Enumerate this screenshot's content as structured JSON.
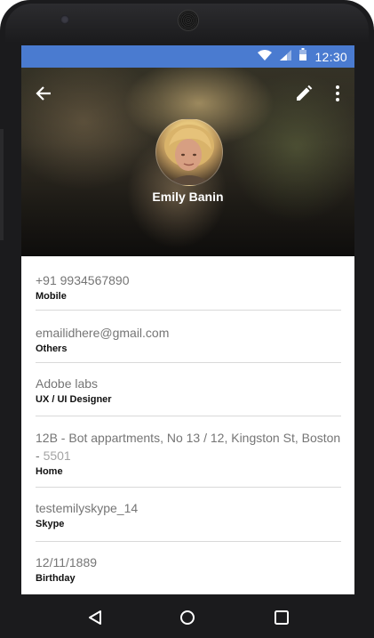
{
  "status_bar": {
    "time": "12:30",
    "icons": [
      "wifi-icon",
      "cellular-signal-icon",
      "battery-icon"
    ],
    "background": "#4a7bd0"
  },
  "toolbar": {
    "back_icon": "arrow-back-icon",
    "edit_icon": "pencil-icon",
    "more_icon": "more-vertical-icon"
  },
  "contact": {
    "name": "Emily Banin",
    "avatar": "avatar-photo"
  },
  "details": [
    {
      "value": "+91 9934567890",
      "suffix": "",
      "label": "Mobile"
    },
    {
      "value": "emailidhere@gmail.com",
      "suffix": "",
      "label": "Others"
    },
    {
      "value": "Adobe labs",
      "suffix": "",
      "label": "UX / UI Designer"
    },
    {
      "value": "12B - Bot appartments, No 13 / 12, Kingston St, Boston - ",
      "suffix": "5501",
      "label": "Home"
    },
    {
      "value": "testemilyskype_14",
      "suffix": "",
      "label": "Skype"
    },
    {
      "value": "12/11/1889",
      "suffix": "",
      "label": "Birthday"
    }
  ],
  "navigation": {
    "back_icon": "triangle-back-icon",
    "home_icon": "circle-home-icon",
    "recents_icon": "square-recents-icon"
  }
}
